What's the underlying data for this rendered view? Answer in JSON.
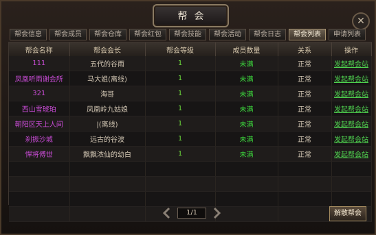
{
  "window": {
    "title": "帮会"
  },
  "tabs": [
    {
      "label": "帮会信息"
    },
    {
      "label": "帮会成员"
    },
    {
      "label": "帮会仓库"
    },
    {
      "label": "帮会红包"
    },
    {
      "label": "帮会技能"
    },
    {
      "label": "帮会活动"
    },
    {
      "label": "帮会日志"
    },
    {
      "label": "帮会列表"
    },
    {
      "label": "申请列表"
    }
  ],
  "active_tab_index": 7,
  "table": {
    "headers": [
      "帮会名称",
      "帮会会长",
      "帮会等级",
      "成员数量",
      "关系",
      "操作"
    ],
    "rows": [
      {
        "name": "111",
        "leader": "五代的谷雨",
        "level": "1",
        "members": "未满",
        "relation": "正常",
        "action": "发起帮会站"
      },
      {
        "name": "凤凰听雨谢会所",
        "leader": "马大姐(离线)",
        "level": "1",
        "members": "未满",
        "relation": "正常",
        "action": "发起帮会站"
      },
      {
        "name": "321",
        "leader": "海哥",
        "level": "1",
        "members": "未满",
        "relation": "正常",
        "action": "发起帮会站"
      },
      {
        "name": "西山雪琥珀",
        "leader": "凤凰岭九姑娘",
        "level": "1",
        "members": "未满",
        "relation": "正常",
        "action": "发起帮会站"
      },
      {
        "name": "朝阳区天上人间",
        "leader": "|(离线)",
        "level": "1",
        "members": "未满",
        "relation": "正常",
        "action": "发起帮会站"
      },
      {
        "name": "刹振沙城",
        "leader": "远古的谷波",
        "level": "1",
        "members": "未满",
        "relation": "正常",
        "action": "发起帮会站"
      },
      {
        "name": "悍将傅世",
        "leader": "飘飘浓仙的幼白",
        "level": "1",
        "members": "未满",
        "relation": "正常",
        "action": "发起帮会站"
      }
    ],
    "empty_rows": 4
  },
  "pager": {
    "label": "1/1"
  },
  "leave_button": {
    "label": "解散帮会"
  },
  "colors": {
    "name": "#c94cd6",
    "green": "#4fd34f"
  }
}
